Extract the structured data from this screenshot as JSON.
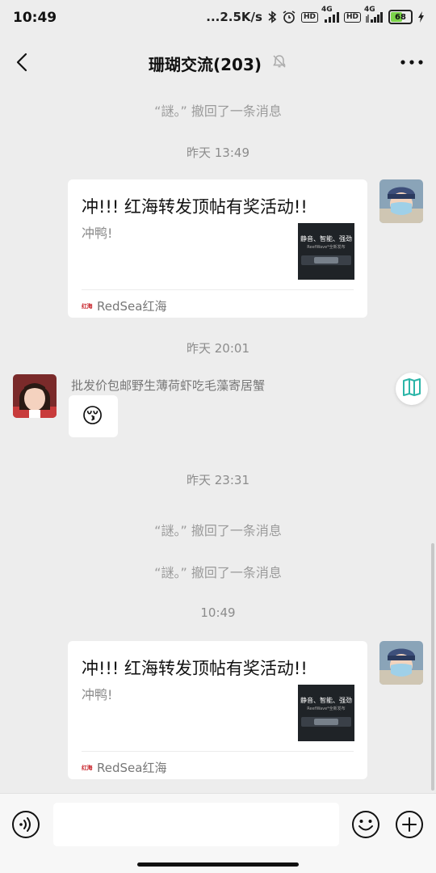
{
  "status_bar": {
    "time": "10:49",
    "net_speed": "...2.5K/s",
    "hd1": "HD",
    "net1": "4G",
    "hd2": "HD",
    "net2": "4G",
    "battery": "68",
    "battery_level": 0.68
  },
  "nav": {
    "title": "珊瑚交流(203)"
  },
  "messages": {
    "recall1": "“謎。” 撤回了一条消息",
    "ts1": "昨天 13:49",
    "card1": {
      "title": "冲!!! 红海转发顶帖有奖活动!!",
      "desc": "冲鸭!",
      "thumb_text": "静音、智能、强劲",
      "thumb_sub": "ReefWave*全新发布",
      "source": "RedSea红海",
      "source_logo": "红海"
    },
    "ts2": "昨天 20:01",
    "sender_name": "批发价包邮野生薄荷虾吃毛藻寄居蟹",
    "emoji": "😚",
    "ts3": "昨天 23:31",
    "recall2": "“謎。” 撤回了一条消息",
    "recall3": "“謎。” 撤回了一条消息",
    "ts4": "10:49",
    "card2": {
      "title": "冲!!! 红海转发顶帖有奖活动!!",
      "desc": "冲鸭!",
      "thumb_text": "静音、智能、强劲",
      "thumb_sub": "ReefWave*全新发布",
      "source": "RedSea红海",
      "source_logo": "红海"
    }
  },
  "icons": {
    "back": "back-arrow-icon",
    "mute": "mute-bell-icon",
    "more": "more-dots-icon",
    "voice": "voice-icon",
    "emoji": "emoji-icon",
    "plus": "plus-icon",
    "float": "mini-program-icon"
  },
  "colors": {
    "background": "#ededed",
    "battery_fill": "#7bd34a",
    "float_icon": "#2bb5a8"
  }
}
